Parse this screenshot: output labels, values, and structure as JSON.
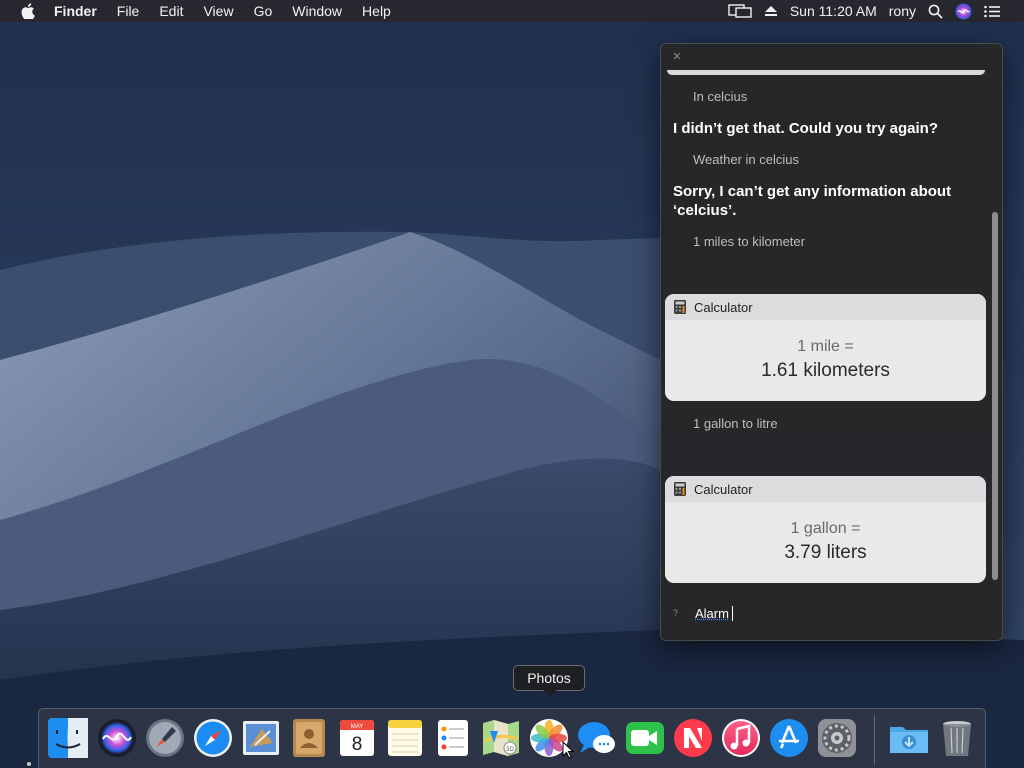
{
  "menubar": {
    "app_name": "Finder",
    "menus": [
      "File",
      "Edit",
      "View",
      "Go",
      "Window",
      "Help"
    ],
    "clock": "Sun 11:20 AM",
    "user": "rony"
  },
  "siri": {
    "conversation": [
      {
        "kind": "query",
        "text": "In celcius"
      },
      {
        "kind": "reply",
        "text": "I didn’t get that. Could you try again?"
      },
      {
        "kind": "query",
        "text": "Weather in celcius"
      },
      {
        "kind": "reply",
        "text": "Sorry, I can’t get any information about ‘celcius’."
      },
      {
        "kind": "query",
        "text": "1 miles to kilometer"
      },
      {
        "kind": "query",
        "text": "1 gallon to litre"
      }
    ],
    "cards": [
      {
        "title": "Calculator",
        "line1": "1 mile =",
        "line2": "1.61 kilometers"
      },
      {
        "title": "Calculator",
        "line1": "1 gallon =",
        "line2": "3.79 liters"
      }
    ],
    "input_value": "Alarm"
  },
  "tooltip": {
    "label": "Photos"
  },
  "dock": {
    "apps": [
      "Finder",
      "Siri",
      "Launchpad",
      "Safari",
      "Mail",
      "Contacts",
      "Calendar",
      "Notes",
      "Reminders",
      "Maps",
      "Photos",
      "Messages",
      "FaceTime",
      "News",
      "iTunes",
      "App Store",
      "System Preferences",
      "Downloads",
      "Trash"
    ],
    "calendar": {
      "month": "MAY",
      "day": "8"
    }
  },
  "colors": {
    "menubar_bg": "#28282c",
    "panel_bg": "#262628",
    "card_bg": "#e9e9ea",
    "accent": "#4a8cff"
  }
}
